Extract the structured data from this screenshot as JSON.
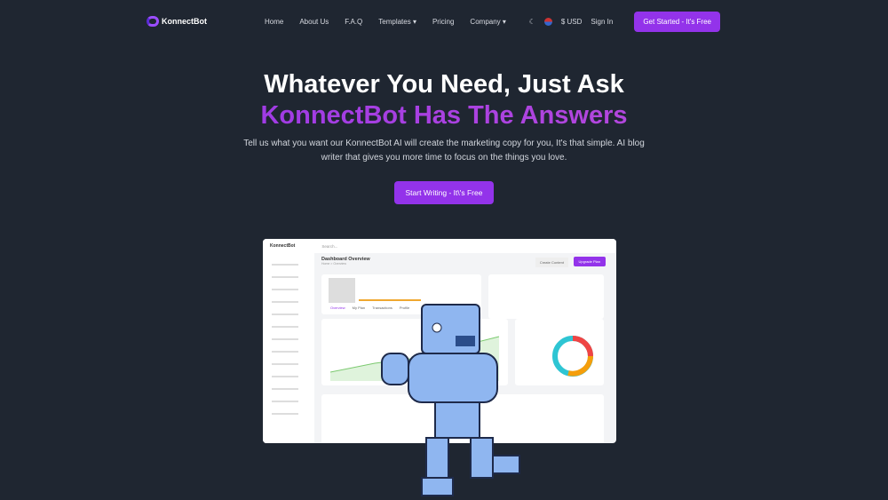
{
  "nav": {
    "brand": "KonnectBot",
    "items": [
      "Home",
      "About Us",
      "F.A.Q",
      "Templates ▾",
      "Pricing",
      "Company ▾"
    ],
    "currency": "$ USD",
    "sign_in": "Sign In",
    "cta": "Get Started - It's Free"
  },
  "hero": {
    "line1": "Whatever You Need, Just Ask",
    "line2": "KonnectBot Has The Answers",
    "subtitle_1": "Tell us what you want our KonnectBot AI will create the marketing copy for you, It's that simple. AI blog",
    "subtitle_2": "writer that gives you more time to focus on the things you love.",
    "button": "Start Writing - It\\'s Free"
  },
  "dashboard": {
    "brand": "KonnectBot",
    "search": "Search...",
    "title": "Dashboard Overview",
    "breadcrumb": "Home > Overview",
    "create": "Create Content",
    "upgrade": "Upgrade Plan",
    "tabs": [
      "Overview",
      "My Plan",
      "Transactions",
      "Profile"
    ]
  }
}
